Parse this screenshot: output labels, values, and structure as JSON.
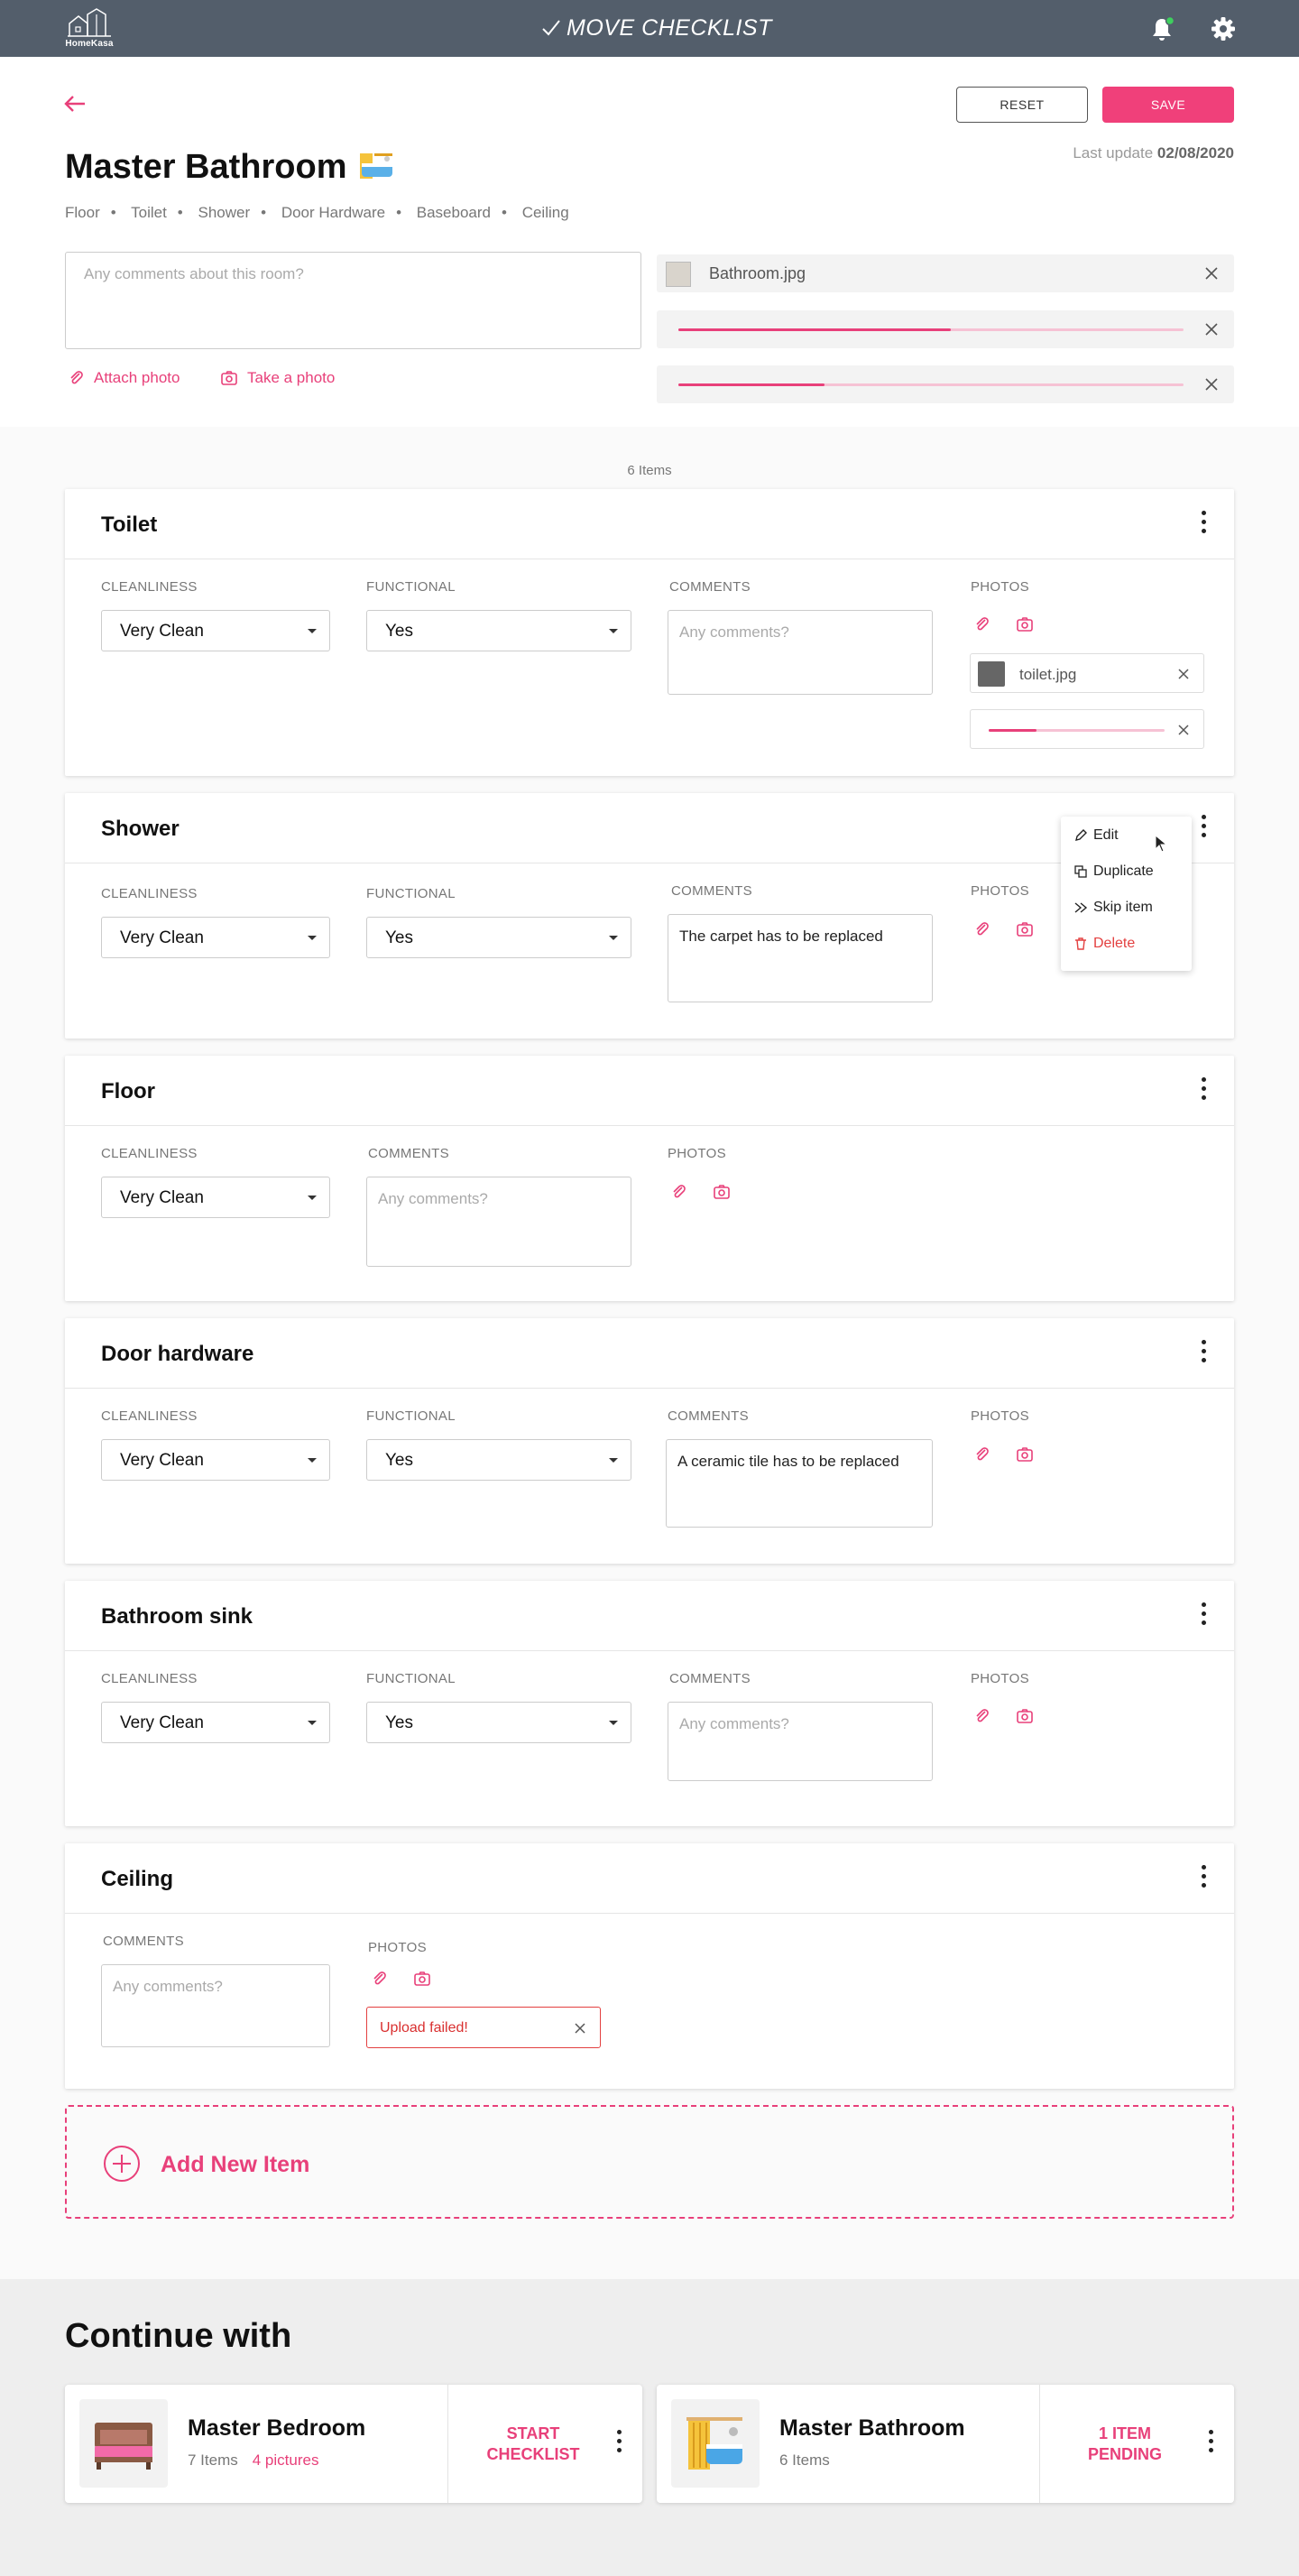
{
  "topbar": {
    "logo_text": "HomeKasa",
    "app_title": "MOVE CHECKLIST"
  },
  "header": {
    "reset_label": "RESET",
    "save_label": "SAVE",
    "last_update_label": "Last update",
    "last_update_date": "02/08/2020",
    "room_title": "Master Bathroom",
    "breadcrumbs": [
      "Floor",
      "Toilet",
      "Shower",
      "Door Hardware",
      "Baseboard",
      "Ceiling"
    ],
    "comment_placeholder": "Any comments about this room?",
    "attach_photo": "Attach photo",
    "take_photo": "Take a photo",
    "files": [
      {
        "name": "Bathroom.jpg"
      },
      {
        "progress": 0.54
      },
      {
        "progress": 0.29
      }
    ]
  },
  "items_count": "6 Items",
  "labels": {
    "cleanliness": "CLEANLINESS",
    "functional": "FUNCTIONAL",
    "comments": "COMMENTS",
    "photos": "PHOTOS"
  },
  "comment_placeholder": "Any comments?",
  "items": [
    {
      "title": "Toilet",
      "cleanliness": "Very Clean",
      "functional": "Yes",
      "comment": "",
      "file": "toilet.jpg",
      "upload_progress": 0.27
    },
    {
      "title": "Shower",
      "cleanliness": "Very Clean",
      "functional": "Yes",
      "comment": "The carpet has to be replaced"
    },
    {
      "title": "Floor",
      "cleanliness": "Very Clean",
      "comment": ""
    },
    {
      "title": "Door hardware",
      "cleanliness": "Very Clean",
      "functional": "Yes",
      "comment": "A ceramic tile has to be replaced"
    },
    {
      "title": "Bathroom sink",
      "cleanliness": "Very Clean",
      "functional": "Yes",
      "comment": ""
    },
    {
      "title": "Ceiling",
      "comment": "",
      "error": "Upload failed!"
    }
  ],
  "context_menu": {
    "edit": "Edit",
    "duplicate": "Duplicate",
    "skip": "Skip item",
    "delete": "Delete"
  },
  "add_new_item": "Add New Item",
  "continue": {
    "title": "Continue with",
    "cards": [
      {
        "name": "Master Bedroom",
        "items": "7 Items",
        "pictures": "4 pictures",
        "action": "START CHECKLIST"
      },
      {
        "name": "Master Bathroom",
        "items": "6 Items",
        "action": "1 ITEM PENDING"
      }
    ]
  },
  "colors": {
    "accent": "#e8407a",
    "topbar": "#535e6b",
    "error": "#e34040"
  }
}
